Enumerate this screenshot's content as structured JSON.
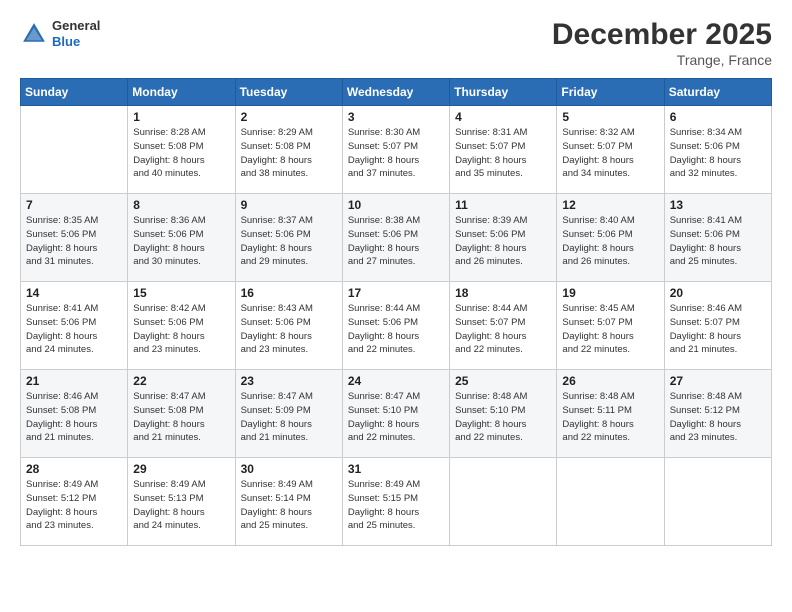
{
  "logo": {
    "line1": "General",
    "line2": "Blue"
  },
  "title": "December 2025",
  "subtitle": "Trange, France",
  "days_header": [
    "Sunday",
    "Monday",
    "Tuesday",
    "Wednesday",
    "Thursday",
    "Friday",
    "Saturday"
  ],
  "weeks": [
    [
      {
        "num": "",
        "info": ""
      },
      {
        "num": "1",
        "info": "Sunrise: 8:28 AM\nSunset: 5:08 PM\nDaylight: 8 hours\nand 40 minutes."
      },
      {
        "num": "2",
        "info": "Sunrise: 8:29 AM\nSunset: 5:08 PM\nDaylight: 8 hours\nand 38 minutes."
      },
      {
        "num": "3",
        "info": "Sunrise: 8:30 AM\nSunset: 5:07 PM\nDaylight: 8 hours\nand 37 minutes."
      },
      {
        "num": "4",
        "info": "Sunrise: 8:31 AM\nSunset: 5:07 PM\nDaylight: 8 hours\nand 35 minutes."
      },
      {
        "num": "5",
        "info": "Sunrise: 8:32 AM\nSunset: 5:07 PM\nDaylight: 8 hours\nand 34 minutes."
      },
      {
        "num": "6",
        "info": "Sunrise: 8:34 AM\nSunset: 5:06 PM\nDaylight: 8 hours\nand 32 minutes."
      }
    ],
    [
      {
        "num": "7",
        "info": "Sunrise: 8:35 AM\nSunset: 5:06 PM\nDaylight: 8 hours\nand 31 minutes."
      },
      {
        "num": "8",
        "info": "Sunrise: 8:36 AM\nSunset: 5:06 PM\nDaylight: 8 hours\nand 30 minutes."
      },
      {
        "num": "9",
        "info": "Sunrise: 8:37 AM\nSunset: 5:06 PM\nDaylight: 8 hours\nand 29 minutes."
      },
      {
        "num": "10",
        "info": "Sunrise: 8:38 AM\nSunset: 5:06 PM\nDaylight: 8 hours\nand 27 minutes."
      },
      {
        "num": "11",
        "info": "Sunrise: 8:39 AM\nSunset: 5:06 PM\nDaylight: 8 hours\nand 26 minutes."
      },
      {
        "num": "12",
        "info": "Sunrise: 8:40 AM\nSunset: 5:06 PM\nDaylight: 8 hours\nand 26 minutes."
      },
      {
        "num": "13",
        "info": "Sunrise: 8:41 AM\nSunset: 5:06 PM\nDaylight: 8 hours\nand 25 minutes."
      }
    ],
    [
      {
        "num": "14",
        "info": "Sunrise: 8:41 AM\nSunset: 5:06 PM\nDaylight: 8 hours\nand 24 minutes."
      },
      {
        "num": "15",
        "info": "Sunrise: 8:42 AM\nSunset: 5:06 PM\nDaylight: 8 hours\nand 23 minutes."
      },
      {
        "num": "16",
        "info": "Sunrise: 8:43 AM\nSunset: 5:06 PM\nDaylight: 8 hours\nand 23 minutes."
      },
      {
        "num": "17",
        "info": "Sunrise: 8:44 AM\nSunset: 5:06 PM\nDaylight: 8 hours\nand 22 minutes."
      },
      {
        "num": "18",
        "info": "Sunrise: 8:44 AM\nSunset: 5:07 PM\nDaylight: 8 hours\nand 22 minutes."
      },
      {
        "num": "19",
        "info": "Sunrise: 8:45 AM\nSunset: 5:07 PM\nDaylight: 8 hours\nand 22 minutes."
      },
      {
        "num": "20",
        "info": "Sunrise: 8:46 AM\nSunset: 5:07 PM\nDaylight: 8 hours\nand 21 minutes."
      }
    ],
    [
      {
        "num": "21",
        "info": "Sunrise: 8:46 AM\nSunset: 5:08 PM\nDaylight: 8 hours\nand 21 minutes."
      },
      {
        "num": "22",
        "info": "Sunrise: 8:47 AM\nSunset: 5:08 PM\nDaylight: 8 hours\nand 21 minutes."
      },
      {
        "num": "23",
        "info": "Sunrise: 8:47 AM\nSunset: 5:09 PM\nDaylight: 8 hours\nand 21 minutes."
      },
      {
        "num": "24",
        "info": "Sunrise: 8:47 AM\nSunset: 5:10 PM\nDaylight: 8 hours\nand 22 minutes."
      },
      {
        "num": "25",
        "info": "Sunrise: 8:48 AM\nSunset: 5:10 PM\nDaylight: 8 hours\nand 22 minutes."
      },
      {
        "num": "26",
        "info": "Sunrise: 8:48 AM\nSunset: 5:11 PM\nDaylight: 8 hours\nand 22 minutes."
      },
      {
        "num": "27",
        "info": "Sunrise: 8:48 AM\nSunset: 5:12 PM\nDaylight: 8 hours\nand 23 minutes."
      }
    ],
    [
      {
        "num": "28",
        "info": "Sunrise: 8:49 AM\nSunset: 5:12 PM\nDaylight: 8 hours\nand 23 minutes."
      },
      {
        "num": "29",
        "info": "Sunrise: 8:49 AM\nSunset: 5:13 PM\nDaylight: 8 hours\nand 24 minutes."
      },
      {
        "num": "30",
        "info": "Sunrise: 8:49 AM\nSunset: 5:14 PM\nDaylight: 8 hours\nand 25 minutes."
      },
      {
        "num": "31",
        "info": "Sunrise: 8:49 AM\nSunset: 5:15 PM\nDaylight: 8 hours\nand 25 minutes."
      },
      {
        "num": "",
        "info": ""
      },
      {
        "num": "",
        "info": ""
      },
      {
        "num": "",
        "info": ""
      }
    ]
  ]
}
